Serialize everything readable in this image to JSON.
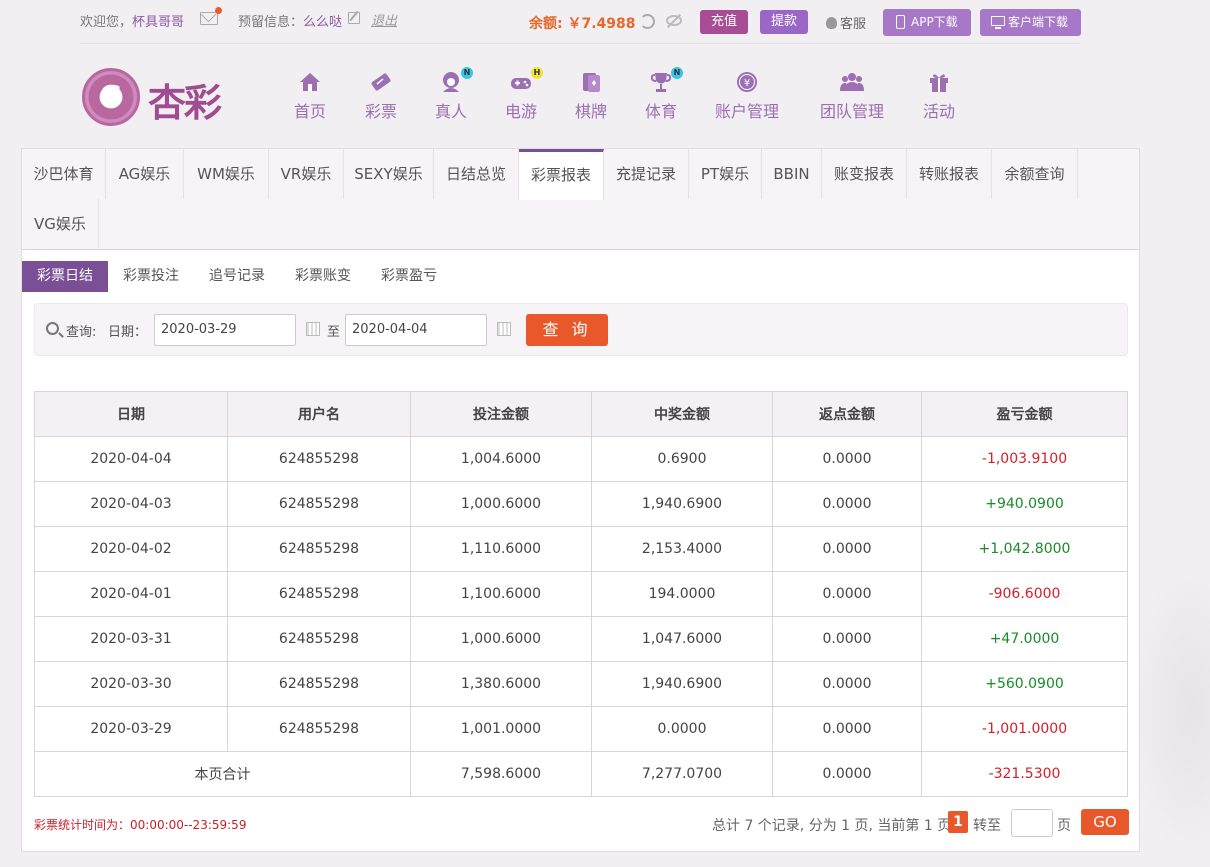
{
  "topbar": {
    "welcome": "欢迎您，",
    "username": "杯具哥哥",
    "reserve_label": "预留信息：",
    "reserve_value": "么么哒",
    "logout": "退出",
    "balance": "余额: ￥7.4988",
    "recharge": "充值",
    "withdraw": "提款",
    "service": "客服",
    "app_download": "APP下载",
    "client_download": "客户端下载"
  },
  "logo": {
    "text": "杏彩",
    "emblem": "G"
  },
  "nav": [
    {
      "label": "首页",
      "icon": "home-icon"
    },
    {
      "label": "彩票",
      "icon": "ticket-icon"
    },
    {
      "label": "真人",
      "icon": "lady-icon",
      "badge": "N"
    },
    {
      "label": "电游",
      "icon": "gamepad-icon",
      "badge": "H"
    },
    {
      "label": "棋牌",
      "icon": "cards-icon"
    },
    {
      "label": "体育",
      "icon": "trophy-icon",
      "badge": "N"
    },
    {
      "label": "账户管理",
      "icon": "yen-coin-icon"
    },
    {
      "label": "团队管理",
      "icon": "team-icon"
    },
    {
      "label": "活动",
      "icon": "gift-icon"
    }
  ],
  "tabs1": [
    "沙巴体育",
    "AG娱乐",
    "WM娱乐",
    "VR娱乐",
    "SEXY娱乐",
    "日结总览",
    "彩票报表",
    "充提记录",
    "PT娱乐",
    "BBIN",
    "账变报表",
    "转账报表",
    "余额查询",
    "VG娱乐"
  ],
  "tabs1_active": "彩票报表",
  "tabs2": [
    "彩票日结",
    "彩票投注",
    "追号记录",
    "彩票账变",
    "彩票盈亏"
  ],
  "tabs2_active": "彩票日结",
  "search": {
    "query_label": "查询:",
    "date_label": "日期：",
    "start_date": "2020-03-29",
    "to_label": "至",
    "end_date": "2020-04-04",
    "button": "查 询"
  },
  "table": {
    "headers": [
      "日期",
      "用户名",
      "投注金额",
      "中奖金额",
      "返点金额",
      "盈亏金额"
    ],
    "rows": [
      [
        "2020-04-04",
        "624855298",
        "1,004.6000",
        "0.6900",
        "0.0000",
        "-1,003.9100"
      ],
      [
        "2020-04-03",
        "624855298",
        "1,000.6000",
        "1,940.6900",
        "0.0000",
        "+940.0900"
      ],
      [
        "2020-04-02",
        "624855298",
        "1,110.6000",
        "2,153.4000",
        "0.0000",
        "+1,042.8000"
      ],
      [
        "2020-04-01",
        "624855298",
        "1,100.6000",
        "194.0000",
        "0.0000",
        "-906.6000"
      ],
      [
        "2020-03-31",
        "624855298",
        "1,000.6000",
        "1,047.6000",
        "0.0000",
        "+47.0000"
      ],
      [
        "2020-03-30",
        "624855298",
        "1,380.6000",
        "1,940.6900",
        "0.0000",
        "+560.0900"
      ],
      [
        "2020-03-29",
        "624855298",
        "1,001.0000",
        "0.0000",
        "0.0000",
        "-1,001.0000"
      ]
    ],
    "total": [
      "本页合计",
      "7,598.6000",
      "7,277.0700",
      "0.0000",
      "-321.5300"
    ]
  },
  "footer_note": "彩票统计时间为：00:00:00--23:59:59",
  "pager": {
    "info": "总计 7 个记录, 分为 1 页, 当前第 1 页",
    "current": "1",
    "goto_label": "转至",
    "page_label": "页",
    "go": "GO"
  },
  "colors": {
    "accent": "#7a4f96",
    "orange": "#e8582a",
    "negative": "#d3202a",
    "positive": "#1a8a2a"
  }
}
